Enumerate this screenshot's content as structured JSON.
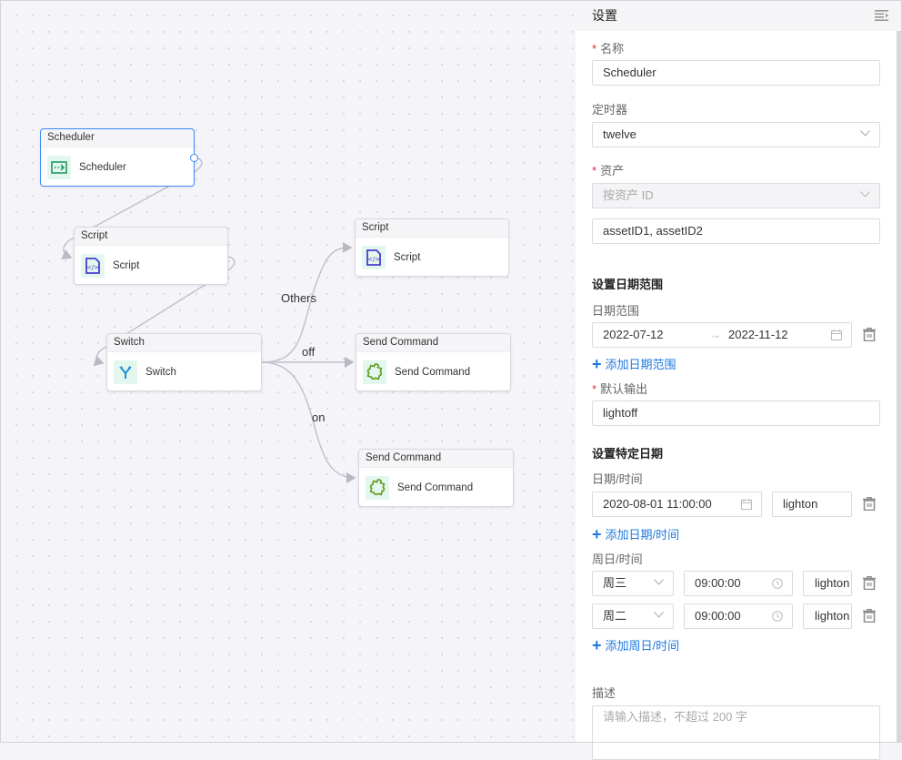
{
  "canvas": {
    "nodes": [
      {
        "id": "scheduler",
        "header": "Scheduler",
        "label": "Scheduler",
        "icon": "scheduler-icon",
        "selected": true
      },
      {
        "id": "script1",
        "header": "Script",
        "label": "Script",
        "icon": "script-icon"
      },
      {
        "id": "switch",
        "header": "Switch",
        "label": "Switch",
        "icon": "switch-icon"
      },
      {
        "id": "script2",
        "header": "Script",
        "label": "Script",
        "icon": "script-icon"
      },
      {
        "id": "send1",
        "header": "Send Command",
        "label": "Send Command",
        "icon": "puzzle-icon"
      },
      {
        "id": "send2",
        "header": "Send Command",
        "label": "Send Command",
        "icon": "puzzle-icon"
      }
    ],
    "edge_labels": {
      "others": "Others",
      "off": "off",
      "on": "on"
    }
  },
  "panel": {
    "title": "设置",
    "name": {
      "label": "名称",
      "required": "*",
      "value": "Scheduler"
    },
    "timer": {
      "label": "定时器",
      "value": "twelve"
    },
    "asset": {
      "label": "资产",
      "required": "*",
      "mode": "按资产 ID",
      "ids": "assetID1, assetID2"
    },
    "date_range_section": "设置日期范围",
    "date_range": {
      "label": "日期范围",
      "start": "2022-07-12",
      "separator": "→",
      "end": "2022-11-12",
      "add": "添加日期范围"
    },
    "default_output": {
      "label": "默认输出",
      "required": "*",
      "value": "lightoff"
    },
    "specific_section": "设置特定日期",
    "datetime": {
      "label": "日期/时间",
      "value": "2020-08-01 11:00:00",
      "output": "lighton",
      "add": "添加日期/时间"
    },
    "weekday": {
      "label": "周日/时间",
      "rows": [
        {
          "day": "周三",
          "time": "09:00:00",
          "output": "lighton"
        },
        {
          "day": "周二",
          "time": "09:00:00",
          "output": "lighton"
        }
      ],
      "add": "添加周日/时间"
    },
    "description": {
      "label": "描述",
      "placeholder": "请输入描述，不超过 200 字"
    }
  }
}
